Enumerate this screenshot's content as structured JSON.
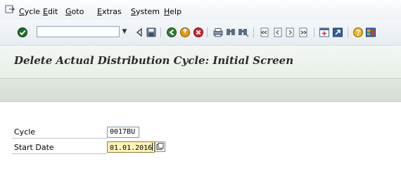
{
  "menu": {
    "items": [
      {
        "label": "Cycle"
      },
      {
        "label": "Edit"
      },
      {
        "label": "Goto"
      },
      {
        "label": "Extras"
      },
      {
        "label": "System"
      },
      {
        "label": "Help"
      }
    ]
  },
  "toolbar": {
    "command_field_value": "",
    "icons": [
      "enter-icon",
      "back-icon",
      "save-icon",
      "back-green-icon",
      "exit-icon",
      "cancel-icon",
      "print-icon",
      "find-icon",
      "find-next-icon",
      "first-page-icon",
      "previous-page-icon",
      "next-page-icon",
      "last-page-icon",
      "create-session-icon",
      "shortcut-icon",
      "help-icon",
      "customize-layout-icon"
    ]
  },
  "page": {
    "title": "Delete Actual Distribution Cycle: Initial Screen"
  },
  "form": {
    "cycle_label": "Cycle",
    "cycle_value": "0017BU",
    "start_date_label": "Start Date",
    "start_date_value": "01.01.2016"
  },
  "colors": {
    "title_bg": "#eef3ee",
    "app_toolbar_bg": "#dbe3db",
    "active_field_bg": "#fff5b8"
  }
}
